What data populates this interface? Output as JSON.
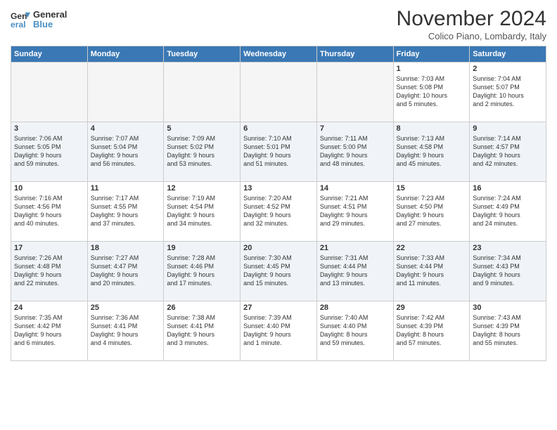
{
  "logo": {
    "line1": "General",
    "line2": "Blue"
  },
  "title": "November 2024",
  "subtitle": "Colico Piano, Lombardy, Italy",
  "headers": [
    "Sunday",
    "Monday",
    "Tuesday",
    "Wednesday",
    "Thursday",
    "Friday",
    "Saturday"
  ],
  "weeks": [
    [
      {
        "day": "",
        "info": ""
      },
      {
        "day": "",
        "info": ""
      },
      {
        "day": "",
        "info": ""
      },
      {
        "day": "",
        "info": ""
      },
      {
        "day": "",
        "info": ""
      },
      {
        "day": "1",
        "info": "Sunrise: 7:03 AM\nSunset: 5:08 PM\nDaylight: 10 hours\nand 5 minutes."
      },
      {
        "day": "2",
        "info": "Sunrise: 7:04 AM\nSunset: 5:07 PM\nDaylight: 10 hours\nand 2 minutes."
      }
    ],
    [
      {
        "day": "3",
        "info": "Sunrise: 7:06 AM\nSunset: 5:05 PM\nDaylight: 9 hours\nand 59 minutes."
      },
      {
        "day": "4",
        "info": "Sunrise: 7:07 AM\nSunset: 5:04 PM\nDaylight: 9 hours\nand 56 minutes."
      },
      {
        "day": "5",
        "info": "Sunrise: 7:09 AM\nSunset: 5:02 PM\nDaylight: 9 hours\nand 53 minutes."
      },
      {
        "day": "6",
        "info": "Sunrise: 7:10 AM\nSunset: 5:01 PM\nDaylight: 9 hours\nand 51 minutes."
      },
      {
        "day": "7",
        "info": "Sunrise: 7:11 AM\nSunset: 5:00 PM\nDaylight: 9 hours\nand 48 minutes."
      },
      {
        "day": "8",
        "info": "Sunrise: 7:13 AM\nSunset: 4:58 PM\nDaylight: 9 hours\nand 45 minutes."
      },
      {
        "day": "9",
        "info": "Sunrise: 7:14 AM\nSunset: 4:57 PM\nDaylight: 9 hours\nand 42 minutes."
      }
    ],
    [
      {
        "day": "10",
        "info": "Sunrise: 7:16 AM\nSunset: 4:56 PM\nDaylight: 9 hours\nand 40 minutes."
      },
      {
        "day": "11",
        "info": "Sunrise: 7:17 AM\nSunset: 4:55 PM\nDaylight: 9 hours\nand 37 minutes."
      },
      {
        "day": "12",
        "info": "Sunrise: 7:19 AM\nSunset: 4:54 PM\nDaylight: 9 hours\nand 34 minutes."
      },
      {
        "day": "13",
        "info": "Sunrise: 7:20 AM\nSunset: 4:52 PM\nDaylight: 9 hours\nand 32 minutes."
      },
      {
        "day": "14",
        "info": "Sunrise: 7:21 AM\nSunset: 4:51 PM\nDaylight: 9 hours\nand 29 minutes."
      },
      {
        "day": "15",
        "info": "Sunrise: 7:23 AM\nSunset: 4:50 PM\nDaylight: 9 hours\nand 27 minutes."
      },
      {
        "day": "16",
        "info": "Sunrise: 7:24 AM\nSunset: 4:49 PM\nDaylight: 9 hours\nand 24 minutes."
      }
    ],
    [
      {
        "day": "17",
        "info": "Sunrise: 7:26 AM\nSunset: 4:48 PM\nDaylight: 9 hours\nand 22 minutes."
      },
      {
        "day": "18",
        "info": "Sunrise: 7:27 AM\nSunset: 4:47 PM\nDaylight: 9 hours\nand 20 minutes."
      },
      {
        "day": "19",
        "info": "Sunrise: 7:28 AM\nSunset: 4:46 PM\nDaylight: 9 hours\nand 17 minutes."
      },
      {
        "day": "20",
        "info": "Sunrise: 7:30 AM\nSunset: 4:45 PM\nDaylight: 9 hours\nand 15 minutes."
      },
      {
        "day": "21",
        "info": "Sunrise: 7:31 AM\nSunset: 4:44 PM\nDaylight: 9 hours\nand 13 minutes."
      },
      {
        "day": "22",
        "info": "Sunrise: 7:33 AM\nSunset: 4:44 PM\nDaylight: 9 hours\nand 11 minutes."
      },
      {
        "day": "23",
        "info": "Sunrise: 7:34 AM\nSunset: 4:43 PM\nDaylight: 9 hours\nand 9 minutes."
      }
    ],
    [
      {
        "day": "24",
        "info": "Sunrise: 7:35 AM\nSunset: 4:42 PM\nDaylight: 9 hours\nand 6 minutes."
      },
      {
        "day": "25",
        "info": "Sunrise: 7:36 AM\nSunset: 4:41 PM\nDaylight: 9 hours\nand 4 minutes."
      },
      {
        "day": "26",
        "info": "Sunrise: 7:38 AM\nSunset: 4:41 PM\nDaylight: 9 hours\nand 3 minutes."
      },
      {
        "day": "27",
        "info": "Sunrise: 7:39 AM\nSunset: 4:40 PM\nDaylight: 9 hours\nand 1 minute."
      },
      {
        "day": "28",
        "info": "Sunrise: 7:40 AM\nSunset: 4:40 PM\nDaylight: 8 hours\nand 59 minutes."
      },
      {
        "day": "29",
        "info": "Sunrise: 7:42 AM\nSunset: 4:39 PM\nDaylight: 8 hours\nand 57 minutes."
      },
      {
        "day": "30",
        "info": "Sunrise: 7:43 AM\nSunset: 4:39 PM\nDaylight: 8 hours\nand 55 minutes."
      }
    ]
  ]
}
